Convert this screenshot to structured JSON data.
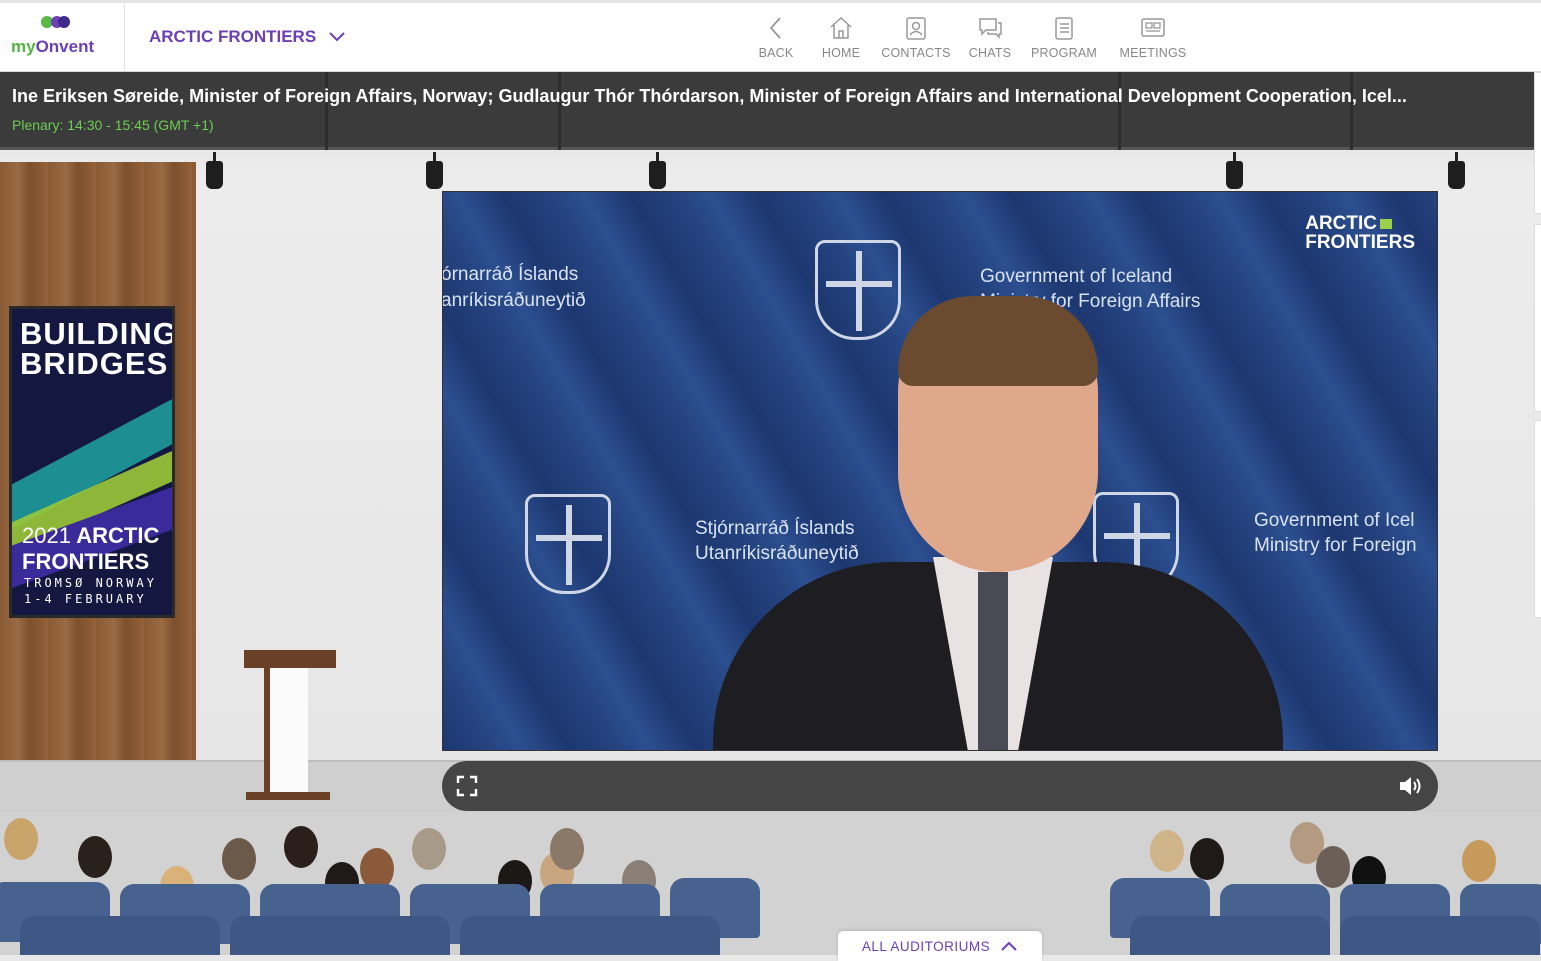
{
  "brand": {
    "name_prefix": "my",
    "name_suffix": "Onvent"
  },
  "event": {
    "title": "ARCTIC FRONTIERS"
  },
  "nav": [
    {
      "label": "BACK",
      "icon": "chevron-left-icon"
    },
    {
      "label": "HOME",
      "icon": "home-icon"
    },
    {
      "label": "CONTACTS",
      "icon": "contacts-icon"
    },
    {
      "label": "CHATS",
      "icon": "chat-icon"
    },
    {
      "label": "PROGRAM",
      "icon": "program-icon"
    },
    {
      "label": "MEETINGS",
      "icon": "meetings-icon"
    }
  ],
  "session": {
    "title": "Ine Eriksen Søreide, Minister of Foreign Affairs, Norway; Gudlaugur Thór Thórdarson, Minister of Foreign Affairs and International Development Cooperation, Icel...",
    "time": "Plenary: 14:30 - 15:45 (GMT +1)"
  },
  "banner": {
    "line1": "BUILDING BRIDGES",
    "line2a": "2021",
    "line2b": "ARCTIC FRONTIERS",
    "line3": "TROMSØ NORWAY 1-4 FEBRUARY"
  },
  "video": {
    "backdrop_text": [
      "órnarráð Íslands",
      "anríkisráðuneytið",
      "Government of Iceland",
      "Ministry for Foreign Affairs",
      "Stjórnarráð Íslands",
      "Utanríkisráðuneytið",
      "Government of Icel",
      "Ministry for Foreign"
    ],
    "logo_line1": "ARCTIC",
    "logo_line2": "FRONTIERS"
  },
  "controls": {
    "fullscreen_icon": "fullscreen-icon",
    "volume_icon": "volume-icon"
  },
  "footer": {
    "all_auditoriums": "ALL AUDITORIUMS"
  },
  "colors": {
    "brand_purple": "#6c3fb4",
    "brand_green": "#58b946",
    "time_green": "#6ccc55"
  }
}
